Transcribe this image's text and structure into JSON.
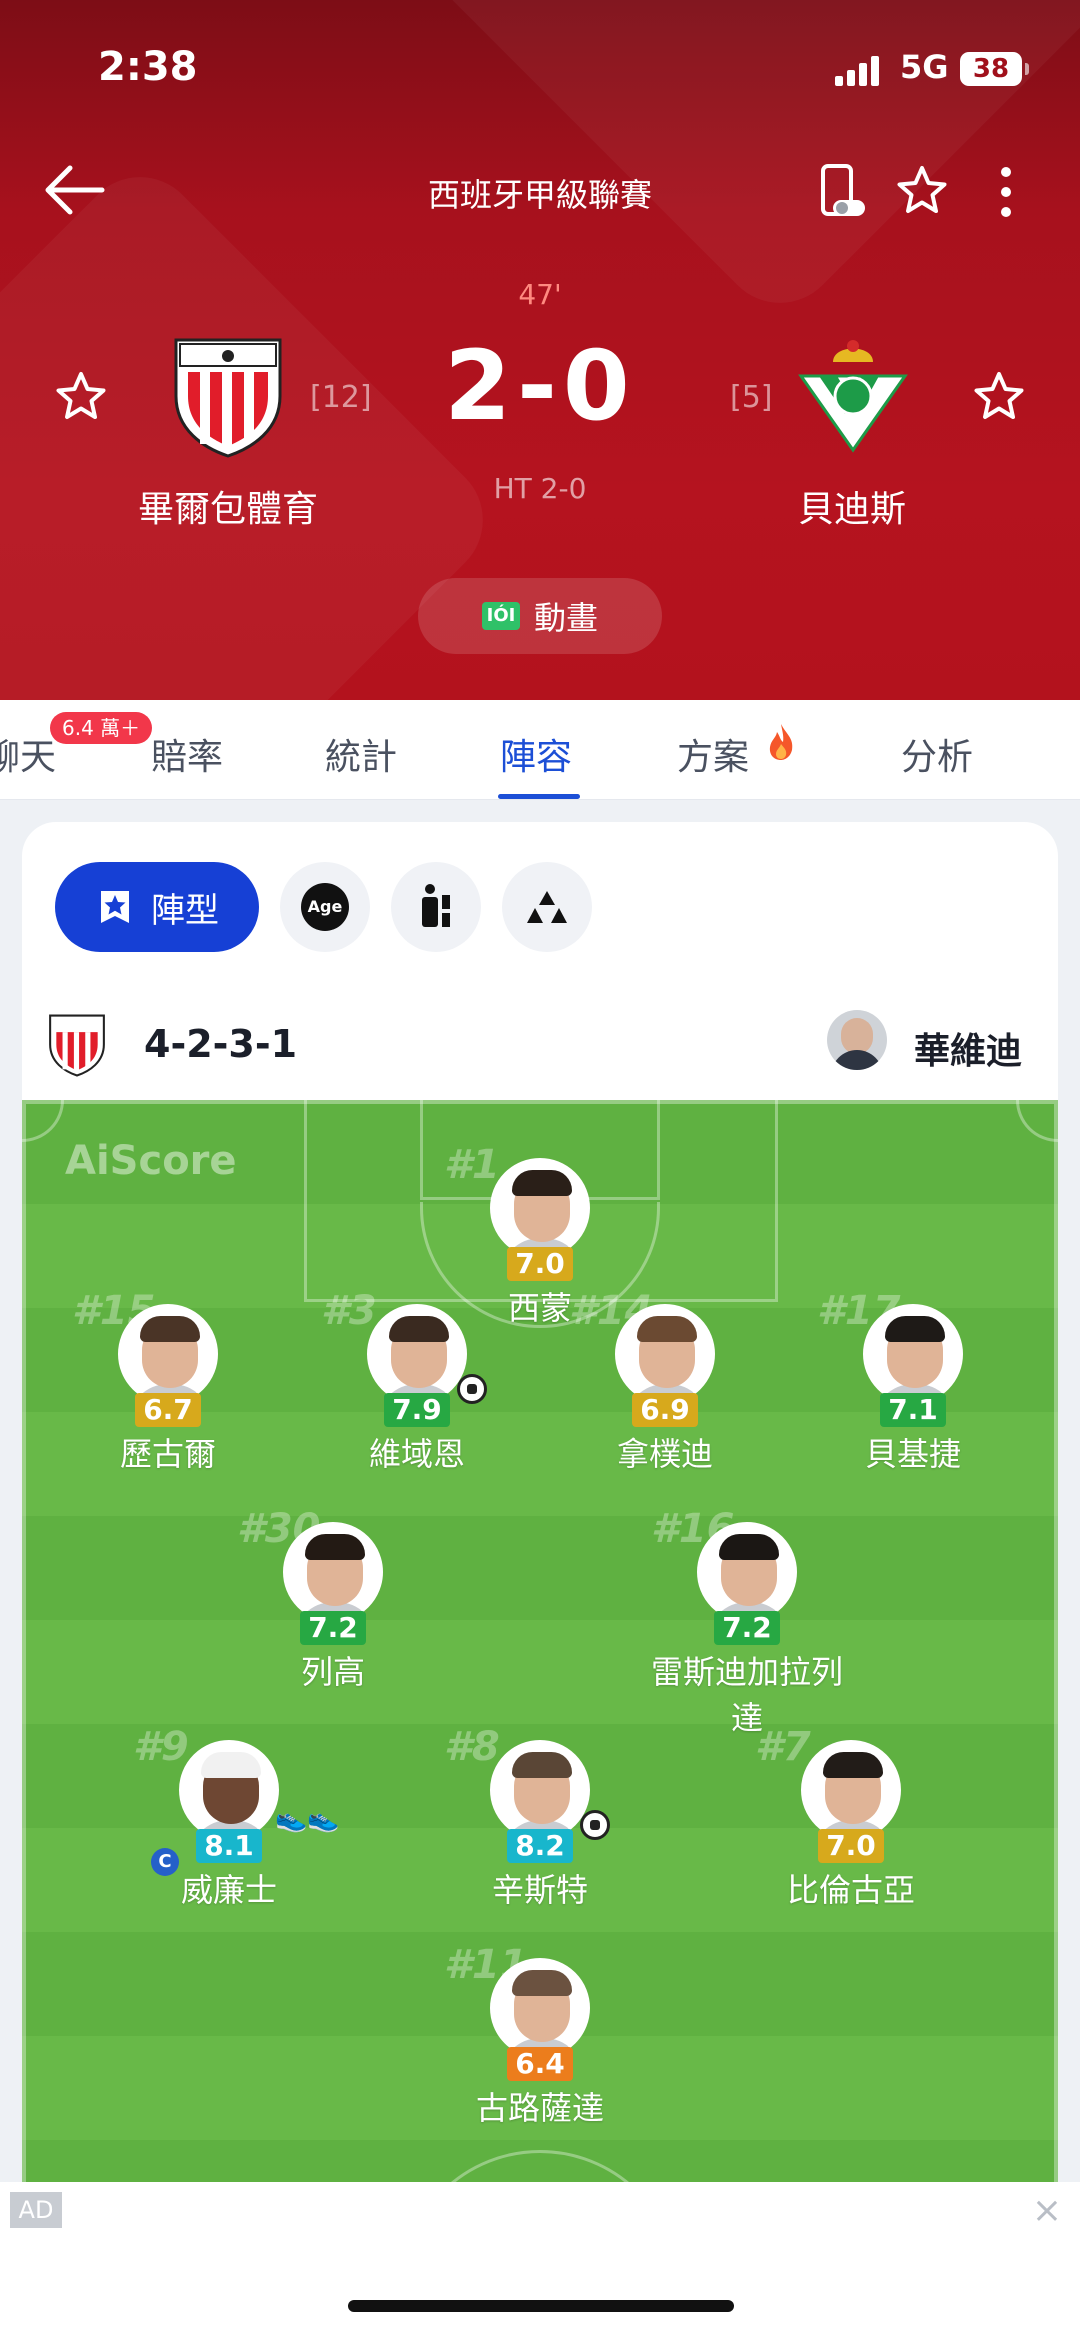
{
  "status_bar": {
    "time": "2:38",
    "network": "5G",
    "battery": "38"
  },
  "header": {
    "title": "西班牙甲級聯賽",
    "minute": "47'",
    "score": "2-0",
    "halftime": "HT 2-0",
    "home": {
      "name": "畢爾包體育",
      "rank": "[12]"
    },
    "away": {
      "name": "貝迪斯",
      "rank": "[5]"
    },
    "animation_label": "動畫",
    "animation_tv_icon": "IÓI"
  },
  "tabs": [
    {
      "label": "聊天",
      "badge": "6.4 萬＋"
    },
    {
      "label": "賠率"
    },
    {
      "label": "統計"
    },
    {
      "label": "陣容",
      "active": true
    },
    {
      "label": "方案"
    },
    {
      "label": "分析"
    }
  ],
  "lineup": {
    "view_chip": "陣型",
    "age_chip": "Age",
    "formation": "4-2-3-1",
    "coach": "華維迪",
    "watermark": "AiScore",
    "players": [
      {
        "number": "#1",
        "name": "西蒙",
        "rating": "7.0",
        "rating_color": "#d7a91c"
      },
      {
        "number": "#15",
        "name": "歷古爾",
        "rating": "6.7",
        "rating_color": "#d7a91c"
      },
      {
        "number": "#3",
        "name": "維域恩",
        "rating": "7.9",
        "rating_color": "#27a843"
      },
      {
        "number": "#14",
        "name": "拿樸迪",
        "rating": "6.9",
        "rating_color": "#d7a91c"
      },
      {
        "number": "#17",
        "name": "貝基捷",
        "rating": "7.1",
        "rating_color": "#27a843"
      },
      {
        "number": "#30",
        "name": "列高",
        "rating": "7.2",
        "rating_color": "#27a843"
      },
      {
        "number": "#16",
        "name": "雷斯迪加拉列達",
        "rating": "7.2",
        "rating_color": "#27a843"
      },
      {
        "number": "#9",
        "name": "威廉士",
        "rating": "8.1",
        "rating_color": "#18b6cc",
        "captain": "C"
      },
      {
        "number": "#8",
        "name": "辛斯特",
        "rating": "8.2",
        "rating_color": "#18b6cc"
      },
      {
        "number": "#7",
        "name": "比倫古亞",
        "rating": "7.0",
        "rating_color": "#d7a91c"
      },
      {
        "number": "#11",
        "name": "古路薩達",
        "rating": "6.4",
        "rating_color": "#ec7d1c"
      }
    ]
  },
  "ad": {
    "tag": "AD",
    "close": "×"
  },
  "icons": [
    "back-arrow-icon",
    "phone-toggle-icon",
    "star-icon",
    "more-vertical-icon",
    "fire-icon",
    "star-badge-icon",
    "substitute-icon",
    "podium-icon",
    "goal-ball-icon",
    "boots-icon",
    "captain-icon"
  ]
}
